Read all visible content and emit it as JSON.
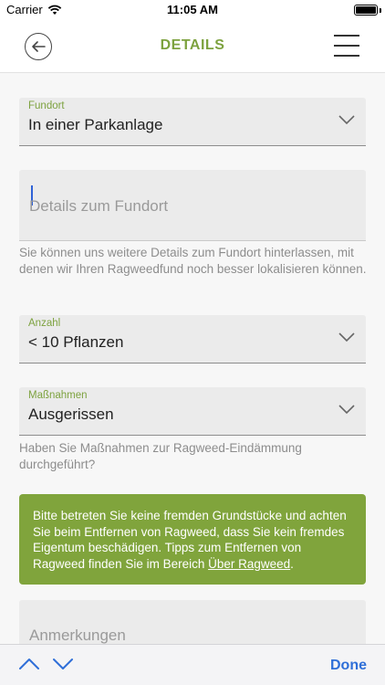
{
  "status_bar": {
    "carrier": "Carrier",
    "time": "11:05 AM"
  },
  "nav": {
    "title": "DETAILS"
  },
  "fundort": {
    "label": "Fundort",
    "value": "In einer Parkanlage"
  },
  "details": {
    "placeholder": "Details zum Fundort"
  },
  "details_helper": "Sie können uns weitere Details zum Fundort hinterlassen, mit denen wir Ihren Ragweedfund noch besser lokalisieren können.",
  "anzahl": {
    "label": "Anzahl",
    "value": "< 10 Pflanzen"
  },
  "massnahmen": {
    "label": "Maßnahmen",
    "value": "Ausgerissen"
  },
  "massnahmen_helper": "Haben Sie Maßnahmen zur Ragweed-Eindämmung durchgeführt?",
  "notice": {
    "text": "Bitte betreten Sie keine fremden Grundstücke und achten Sie beim Entfernen von Ragweed, dass Sie kein fremdes Eigentum beschädigen. Tipps zum Entfernen von Ragweed finden Sie im Bereich ",
    "link": "Über Ragweed",
    "suffix": "."
  },
  "anmerkungen": {
    "placeholder": "Anmerkungen"
  },
  "keyboard_bar": {
    "done": "Done"
  },
  "colors": {
    "accent": "#7da23f",
    "notice_bg": "#80a43c",
    "keyboard_blue": "#2f6fd8"
  }
}
